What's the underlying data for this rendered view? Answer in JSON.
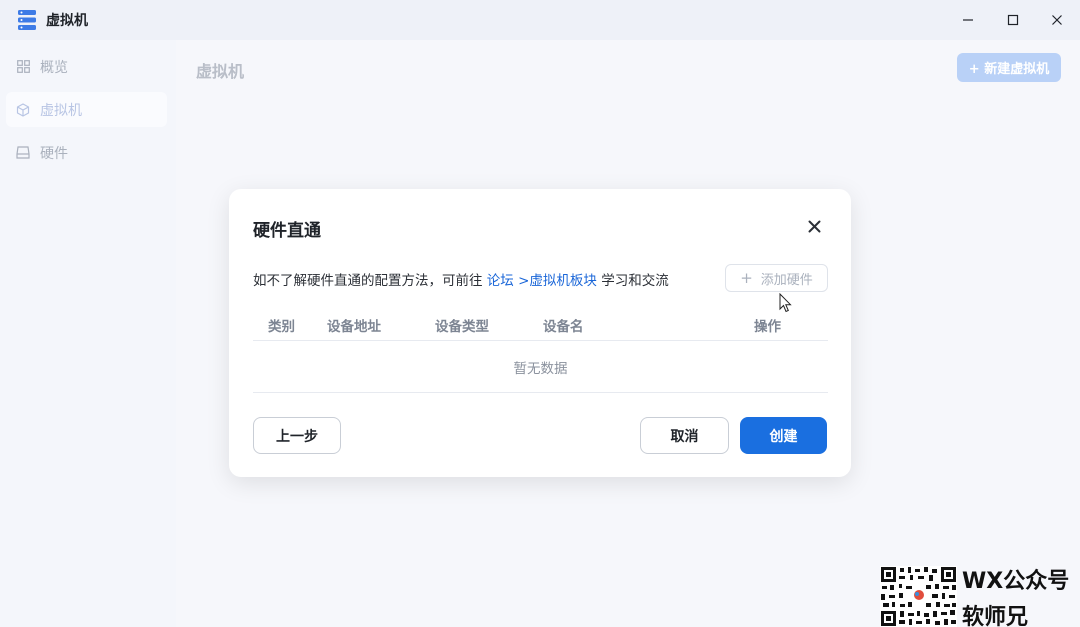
{
  "window": {
    "title": "虚拟机",
    "min_symbol": "—",
    "max_symbol": "☐",
    "close_symbol": "✕",
    "app_icon": "server-stack-icon"
  },
  "sidebar": {
    "items": [
      {
        "label": "概览",
        "icon": "grid-icon",
        "active": false
      },
      {
        "label": "虚拟机",
        "icon": "cube-icon",
        "active": true
      },
      {
        "label": "硬件",
        "icon": "drive-icon",
        "active": false
      }
    ]
  },
  "main": {
    "title": "虚拟机",
    "new_vm_button": "+ 新建虚拟机"
  },
  "modal": {
    "title": "硬件直通",
    "hint_prefix": "如不了解硬件直通的配置方法，可前往 ",
    "hint_link": "论坛 >虚拟机板块",
    "hint_suffix": " 学习和交流",
    "add_button_plus": "+",
    "add_button_label": "添加硬件",
    "columns": [
      "类别",
      "设备地址",
      "设备类型",
      "设备名",
      "操作"
    ],
    "empty_text": "暂无数据",
    "prev_button": "上一步",
    "cancel_button": "取消",
    "create_button": "创建"
  },
  "watermark": {
    "line1": "WX公众号",
    "line2": "软师兄"
  },
  "colors": {
    "primary": "#1a6fe0",
    "link": "#1a66d8",
    "disabled_primary": "#b9d1f7"
  }
}
